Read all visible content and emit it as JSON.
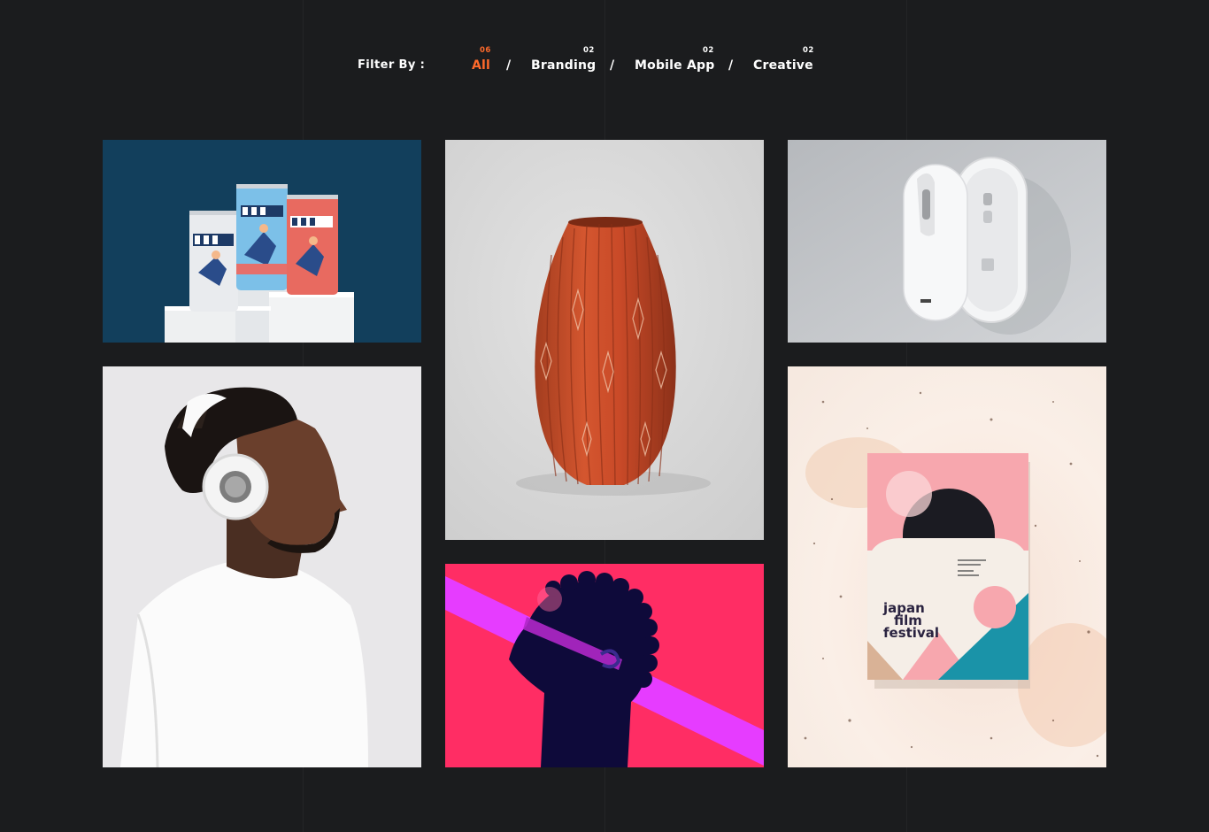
{
  "filter": {
    "label": "Filter By :",
    "items": [
      {
        "label": "All",
        "count": "06",
        "active": true
      },
      {
        "label": "Branding",
        "count": "02"
      },
      {
        "label": "Mobile App",
        "count": "02"
      },
      {
        "label": "Creative",
        "count": "02"
      }
    ],
    "separator": "/",
    "accent_color": "#ff6a2b"
  },
  "portfolio": {
    "items": [
      {
        "name": "beverage-cans",
        "bg_color": "#123f5c"
      },
      {
        "name": "orange-vase",
        "bg_color": "#d9d9d9"
      },
      {
        "name": "white-mouse",
        "bg_color": "#c3c6ca"
      },
      {
        "name": "man-headphones",
        "bg_color": "#e8e7e9"
      },
      {
        "name": "profile-illustration",
        "bg_color": "#ff2d64"
      },
      {
        "name": "festival-poster",
        "bg_color": "#f8eee5",
        "poster_text": [
          "japan",
          "film",
          "festival"
        ]
      }
    ]
  }
}
